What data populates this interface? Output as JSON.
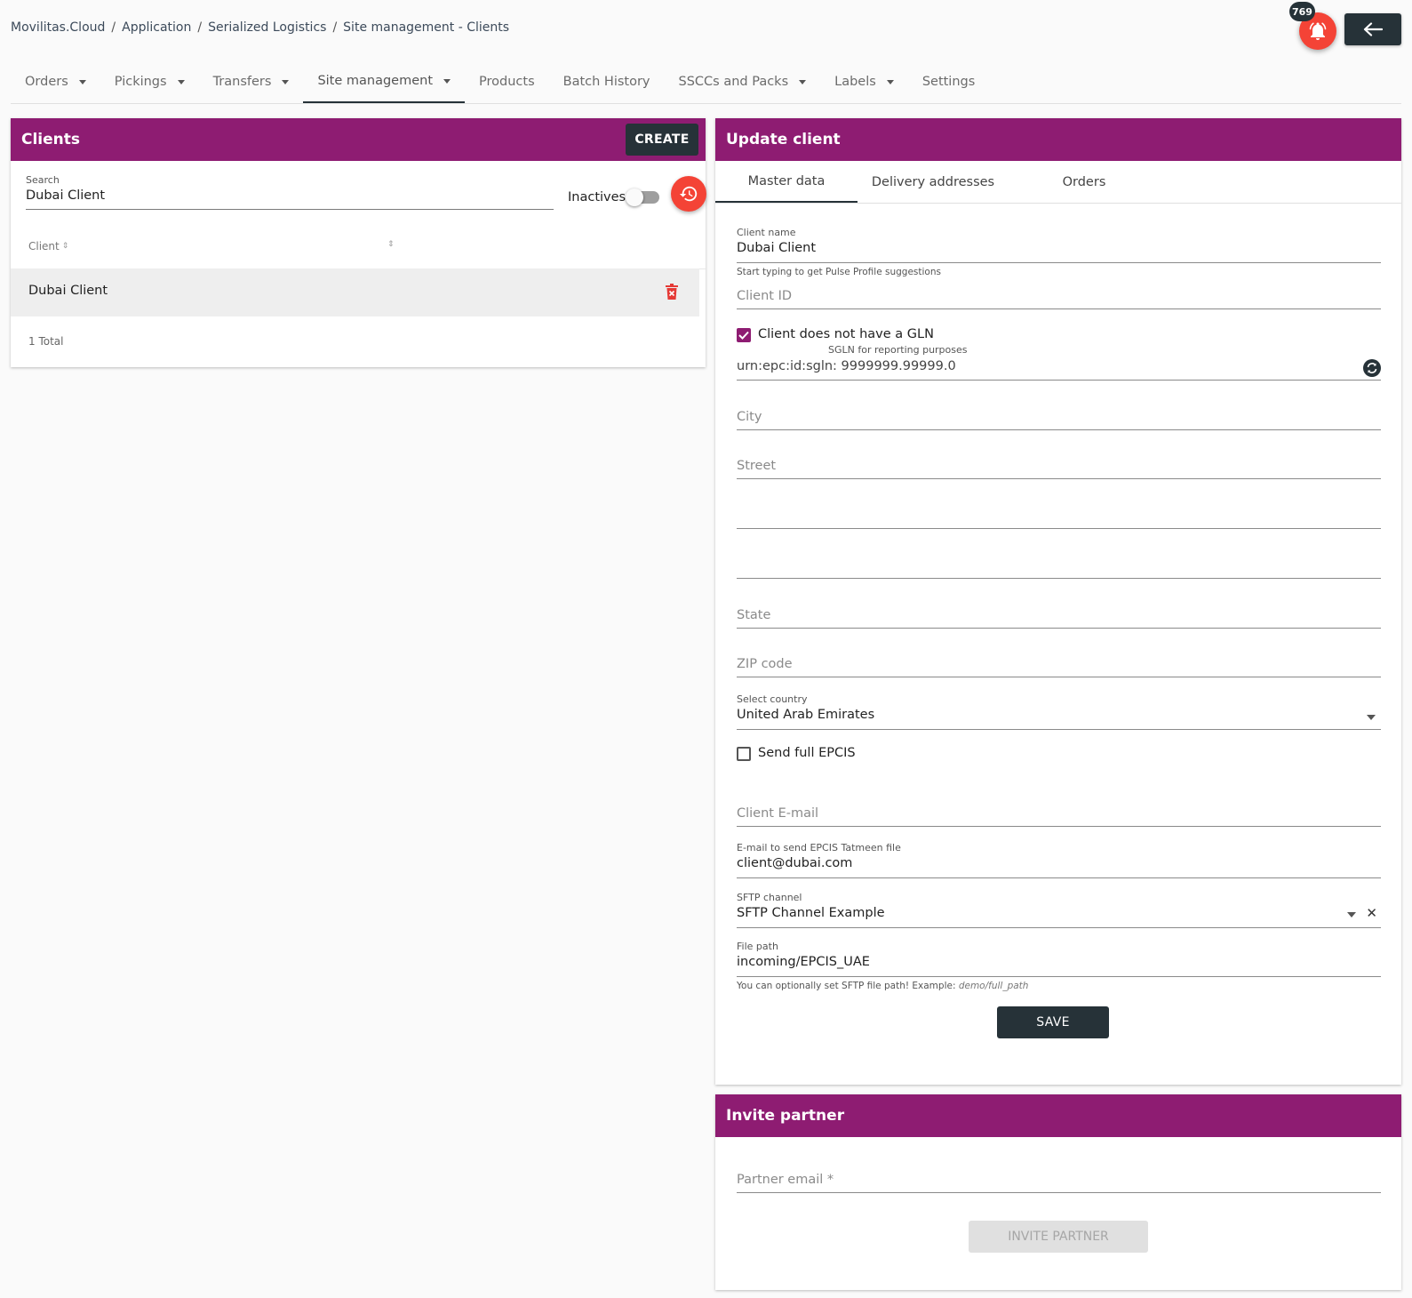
{
  "breadcrumb": [
    "Movilitas.Cloud",
    "Application",
    "Serialized Logistics",
    "Site management - Clients"
  ],
  "notifications": {
    "count": "769"
  },
  "nav": [
    {
      "label": "Orders",
      "dropdown": true
    },
    {
      "label": "Pickings",
      "dropdown": true
    },
    {
      "label": "Transfers",
      "dropdown": true
    },
    {
      "label": "Site management",
      "dropdown": true,
      "active": true
    },
    {
      "label": "Products",
      "dropdown": false
    },
    {
      "label": "Batch History",
      "dropdown": false
    },
    {
      "label": "SSCCs and Packs",
      "dropdown": true
    },
    {
      "label": "Labels",
      "dropdown": true
    },
    {
      "label": "Settings",
      "dropdown": false
    }
  ],
  "clients": {
    "title": "Clients",
    "create_label": "CREATE",
    "search_label": "Search",
    "search_value": "Dubai Client",
    "inactives_label": "Inactives",
    "column_client": "Client",
    "rows": [
      "Dubai Client"
    ],
    "total": "1 Total"
  },
  "update": {
    "title": "Update client",
    "tabs": [
      "Master data",
      "Delivery addresses",
      "Orders"
    ],
    "client_name_label": "Client name",
    "client_name_value": "Dubai Client",
    "client_name_hint": "Start typing to get Pulse Profile suggestions",
    "client_id_placeholder": "Client ID",
    "no_gln_label": "Client does not have a GLN",
    "no_gln_checked": true,
    "sgln_label": "SGLN for reporting purposes",
    "sgln_value": "urn:epc:id:sgln: 9999999.99999.0",
    "city_placeholder": "City",
    "street_placeholder": "Street",
    "state_placeholder": "State",
    "zip_placeholder": "ZIP code",
    "country_label": "Select country",
    "country_value": "United Arab Emirates",
    "send_epcis_label": "Send full EPCIS",
    "send_epcis_checked": false,
    "email_placeholder": "Client E-mail",
    "epcis_email_label": "E-mail to send EPCIS Tatmeen file",
    "epcis_email_value": "client@dubai.com",
    "sftp_label": "SFTP channel",
    "sftp_value": "SFTP Channel Example",
    "file_path_label": "File path",
    "file_path_value": "incoming/EPCIS_UAE",
    "file_path_hint": "You can optionally set SFTP file path! Example: ",
    "file_path_example": "demo/full_path",
    "save_label": "SAVE"
  },
  "invite": {
    "title": "Invite partner",
    "email_placeholder": "Partner email *",
    "button_label": "INVITE PARTNER"
  },
  "colors": {
    "header_purple": "#8e1c72",
    "dark": "#263238",
    "alert_red": "#f44336"
  }
}
